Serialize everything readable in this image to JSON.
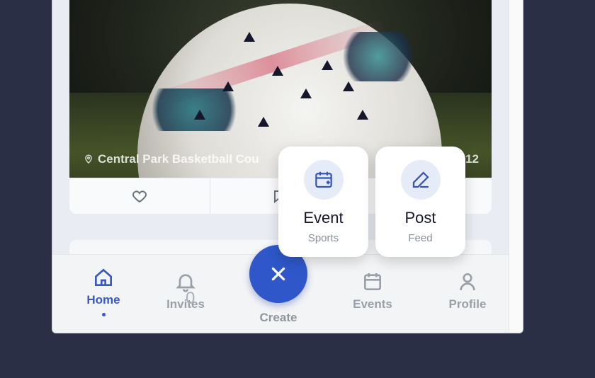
{
  "post": {
    "location": "Central Park Basketball Cou",
    "timestamp": "12"
  },
  "tabbar": {
    "home": "Home",
    "invites": "Invites",
    "invite_count": "0",
    "create": "Create",
    "events": "Events",
    "profile": "Profile"
  },
  "create_menu": {
    "event": {
      "title": "Event",
      "subtitle": "Sports"
    },
    "post": {
      "title": "Post",
      "subtitle": "Feed"
    }
  },
  "colors": {
    "accent": "#2f57c9",
    "background": "#2b2f45"
  }
}
